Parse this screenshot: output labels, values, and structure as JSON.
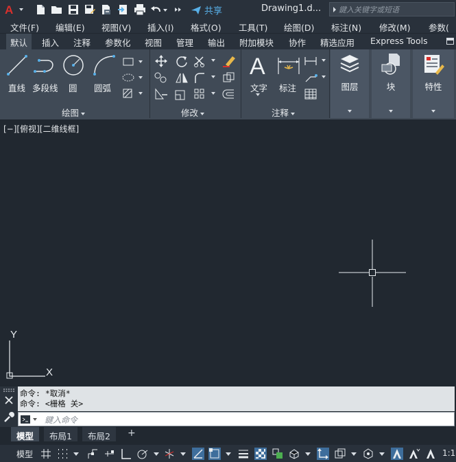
{
  "app": {
    "document_title": "Drawing1.d...",
    "share_label": "共享",
    "search_placeholder": "鍵入关键字或短语"
  },
  "menu": [
    "文件(F)",
    "编辑(E)",
    "视图(V)",
    "插入(I)",
    "格式(O)",
    "工具(T)",
    "绘图(D)",
    "标注(N)",
    "修改(M)",
    "参数("
  ],
  "ribbon_tabs": [
    "默认",
    "插入",
    "注释",
    "参数化",
    "视图",
    "管理",
    "输出",
    "附加模块",
    "协作",
    "精选应用",
    "Express Tools"
  ],
  "active_tab": "默认",
  "ribbon": {
    "draw": {
      "panel_label": "绘图",
      "line": "直线",
      "polyline": "多段线",
      "circle": "圆",
      "arc": "圆弧"
    },
    "modify": {
      "panel_label": "修改"
    },
    "annotation": {
      "panel_label": "注释",
      "text": "文字",
      "dimension": "标注"
    },
    "layers": "图层",
    "block": "块",
    "properties": "特性"
  },
  "viewport_label": "[−][俯视][二维线框]",
  "axes": {
    "y": "Y",
    "x": "X"
  },
  "command": {
    "history": [
      "命令: *取消*",
      "命令:  <栅格 关>"
    ],
    "input_placeholder": "鍵入命令"
  },
  "layout_tabs": [
    "模型",
    "布局1",
    "布局2"
  ],
  "status": {
    "model": "模型",
    "scale": "1:1"
  },
  "colors": {
    "background": "#212830",
    "ribbon": "#404a56",
    "accent": "#58b0e8",
    "logo_red": "#d9302c"
  }
}
